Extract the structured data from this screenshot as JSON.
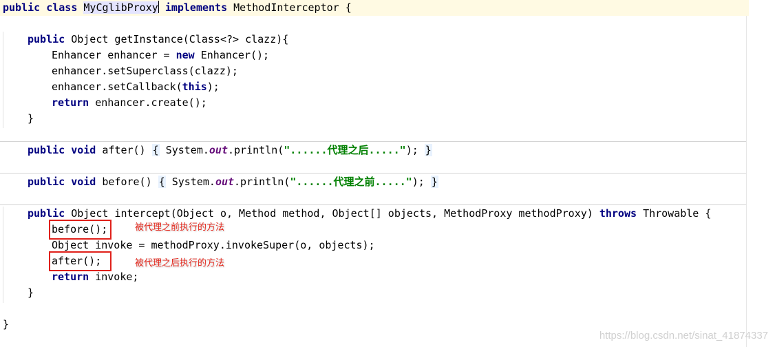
{
  "code": {
    "line1": {
      "kw1": "public",
      "kw2": "class",
      "class_name": "MyCglibProxy",
      "kw3": "implements",
      "iface": "MethodInterceptor {"
    },
    "line3": {
      "kw1": "public",
      "rest": "Object getInstance(Class<?> clazz){"
    },
    "line4": {
      "pre": "Enhancer enhancer = ",
      "kw": "new",
      "post": "Enhancer();"
    },
    "line5": {
      "text": "enhancer.setSuperclass(clazz);"
    },
    "line6": {
      "pre": "enhancer.setCallback(",
      "kw": "this",
      "post": ");"
    },
    "line7": {
      "kw": "return",
      "post": "enhancer.create();"
    },
    "line8": {
      "text": "}"
    },
    "line10": {
      "kw1": "public",
      "kw2": "void",
      "name": "after()",
      "open": "{",
      "sys": "System.",
      "field": "out",
      "call": ".println(",
      "str": "\"......代理之后.....\"",
      "close_call": ");",
      "close": "}"
    },
    "line12": {
      "kw1": "public",
      "kw2": "void",
      "name": "before()",
      "open": "{",
      "sys": "System.",
      "field": "out",
      "call": ".println(",
      "str": "\"......代理之前.....\"",
      "close_call": ");",
      "close": "}"
    },
    "line14": {
      "kw1": "public",
      "rest": "Object intercept(Object o, Method method, Object[] objects, MethodProxy methodProxy)",
      "kw2": "throws",
      "post": "Throwable {"
    },
    "line15": {
      "text": "before();"
    },
    "line16": {
      "text": "Object invoke = methodProxy.invokeSuper(o, objects);"
    },
    "line17": {
      "text": "after();"
    },
    "line18": {
      "kw": "return",
      "post": "invoke;"
    },
    "line19": {
      "text": "}"
    },
    "line21": {
      "text": "}"
    }
  },
  "annotations": {
    "before_note": "被代理之前执行的方法",
    "after_note": "被代理之后执行的方法"
  },
  "watermark": "https://blog.csdn.net/sinat_41874337",
  "colors": {
    "keyword": "#000080",
    "string": "#008000",
    "static_field": "#660e7a",
    "annotation_red": "#e3261b",
    "current_line": "#fffae3"
  }
}
